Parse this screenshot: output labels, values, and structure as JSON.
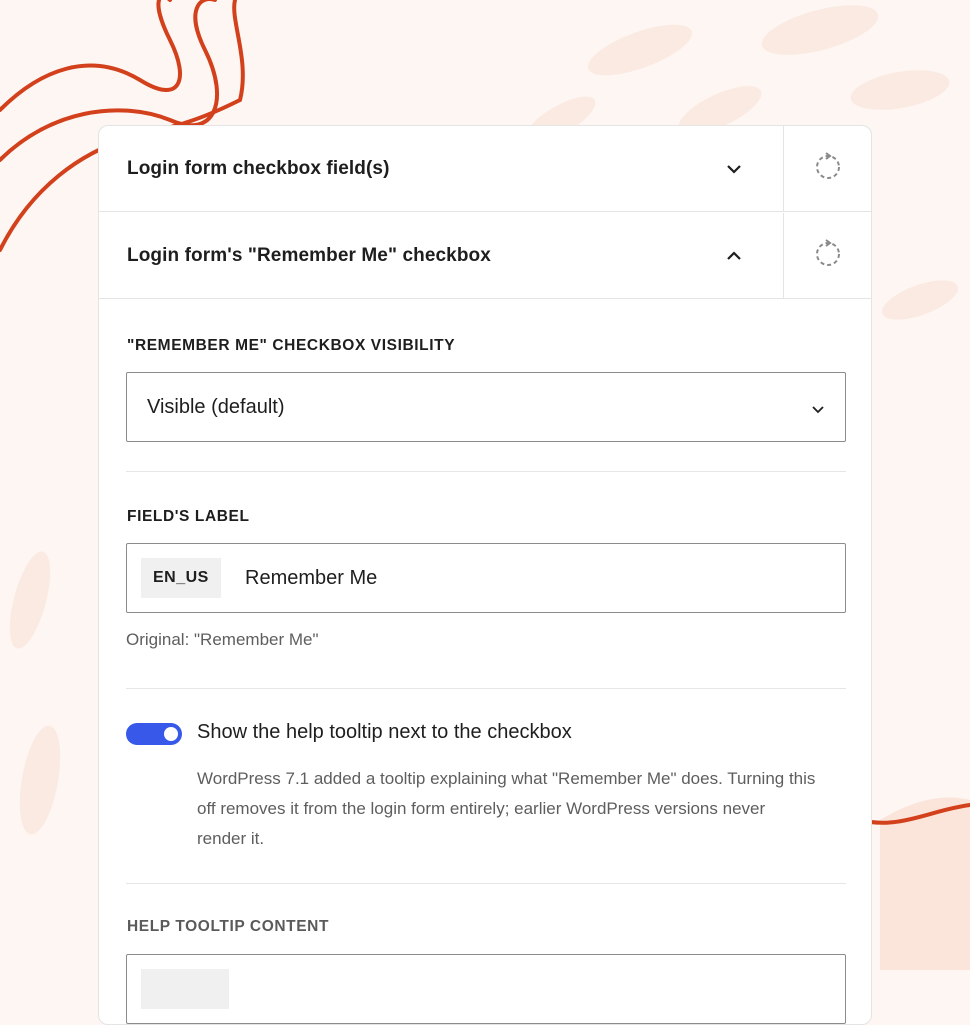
{
  "accordion": {
    "checkbox_fields": {
      "title": "Login form checkbox field(s)",
      "state": "collapsed"
    },
    "remember_me": {
      "title": "Login form's \"Remember Me\" checkbox",
      "state": "expanded"
    }
  },
  "visibility": {
    "label": "\"REMEMBER ME\" CHECKBOX VISIBILITY",
    "selected": "Visible (default)"
  },
  "field_label": {
    "label": "FIELD'S LABEL",
    "locale": "EN_US",
    "value": "Remember Me",
    "original": "Original: \"Remember Me\""
  },
  "tooltip_toggle": {
    "label": "Show the help tooltip next to the checkbox",
    "checked": true,
    "help": "WordPress 7.1 added a tooltip explaining what \"Remember Me\" does. Turning this off removes it from the login form entirely; earlier WordPress versions never render it."
  },
  "tooltip_content": {
    "label": "HELP TOOLTIP CONTENT"
  },
  "icons": {
    "chevron_down": "chevron-down-icon",
    "chevron_up": "chevron-up-icon",
    "reset": "reset-icon"
  },
  "colors": {
    "accent": "#3858e9",
    "decor_line": "#d2401c",
    "background": "#fdf6f2",
    "decor_shape": "#fbe4d9"
  }
}
